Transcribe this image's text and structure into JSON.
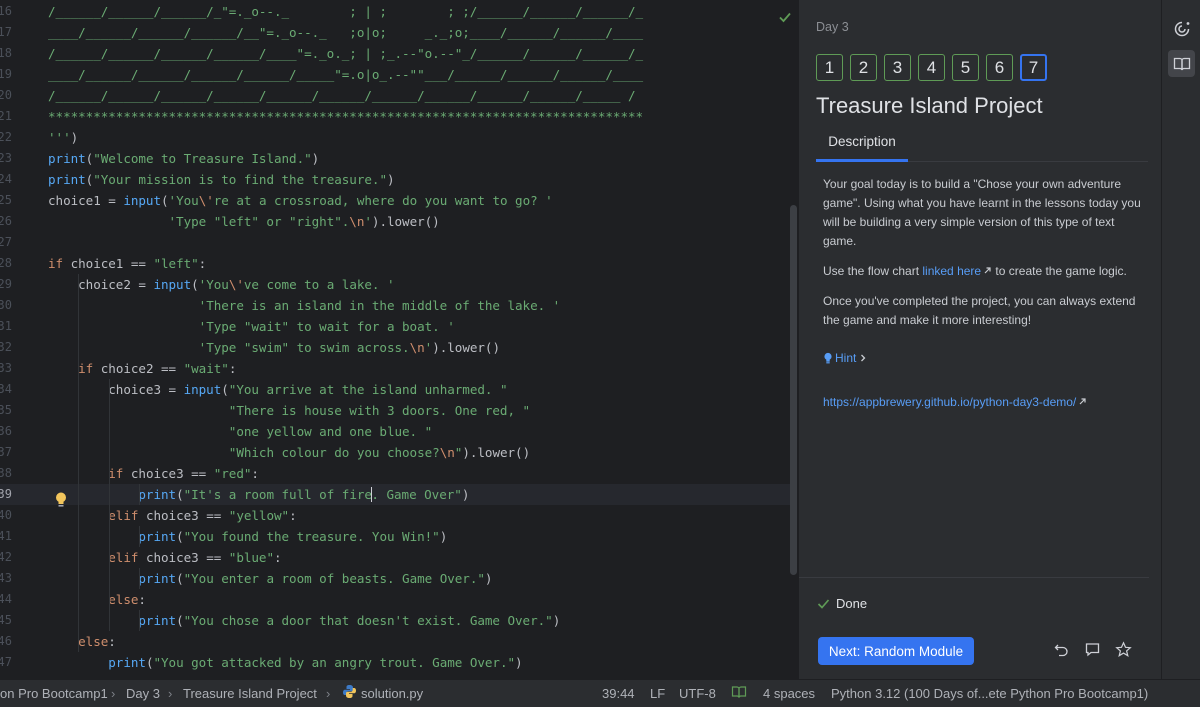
{
  "editor": {
    "lines": [
      {
        "n": "16",
        "text": "/______/______/______/_\"=._o--._        ; | ;        ; ;/______/______/______/_"
      },
      {
        "n": "17",
        "text": "____/______/______/______/__\"=._o--._   ;o|o;     _._;o;____/______/______/____"
      },
      {
        "n": "18",
        "text": "/______/______/______/______/____\"=._o._; | ;_.--\"o.--\"_/______/______/______/_"
      },
      {
        "n": "19",
        "text": "____/______/______/______/______/_____\"=.o|o_.--\"\"___/______/______/______/____"
      },
      {
        "n": "20",
        "text": "/______/______/______/______/______/______/______/______/______/______/_____ /"
      },
      {
        "n": "21",
        "text": "*******************************************************************************"
      },
      {
        "n": "22",
        "text": "''')"
      },
      {
        "n": "23",
        "text": "print(\"Welcome to Treasure Island.\")"
      },
      {
        "n": "24",
        "text": "print(\"Your mission is to find the treasure.\")"
      },
      {
        "n": "25",
        "text": "choice1 = input('You\\'re at a crossroad, where do you want to go? '"
      },
      {
        "n": "26",
        "text": "                'Type \"left\" or \"right\".\\n').lower()"
      },
      {
        "n": "27",
        "text": ""
      },
      {
        "n": "28",
        "text": "if choice1 == \"left\":"
      },
      {
        "n": "29",
        "text": "    choice2 = input('You\\'ve come to a lake. '"
      },
      {
        "n": "30",
        "text": "                    'There is an island in the middle of the lake. '"
      },
      {
        "n": "31",
        "text": "                    'Type \"wait\" to wait for a boat. '"
      },
      {
        "n": "32",
        "text": "                    'Type \"swim\" to swim across.\\n').lower()"
      },
      {
        "n": "33",
        "text": "    if choice2 == \"wait\":"
      },
      {
        "n": "34",
        "text": "        choice3 = input(\"You arrive at the island unharmed. \""
      },
      {
        "n": "35",
        "text": "                        \"There is house with 3 doors. One red, \""
      },
      {
        "n": "36",
        "text": "                        \"one yellow and one blue. \""
      },
      {
        "n": "37",
        "text": "                        \"Which colour do you choose?\\n\").lower()"
      },
      {
        "n": "38",
        "text": "        if choice3 == \"red\":"
      },
      {
        "n": "39",
        "text": "            print(\"It's a room full of fire. Game Over\")"
      },
      {
        "n": "40",
        "text": "        elif choice3 == \"yellow\":"
      },
      {
        "n": "41",
        "text": "            print(\"You found the treasure. You Win!\")"
      },
      {
        "n": "42",
        "text": "        elif choice3 == \"blue\":"
      },
      {
        "n": "43",
        "text": "            print(\"You enter a room of beasts. Game Over.\")"
      },
      {
        "n": "44",
        "text": "        else:"
      },
      {
        "n": "45",
        "text": "            print(\"You chose a door that doesn't exist. Game Over.\")"
      },
      {
        "n": "46",
        "text": "    else:"
      },
      {
        "n": "47",
        "text": "        print(\"You got attacked by an angry trout. Game Over.\")"
      }
    ],
    "current_line": "39",
    "caret_after_text": "print(\"It's a room full of fire"
  },
  "panel": {
    "day_label": "Day 3",
    "task_numbers": [
      "1",
      "2",
      "3",
      "4",
      "5",
      "6",
      "7"
    ],
    "active_task": "7",
    "title": "Treasure Island Project",
    "tab_description": "Description",
    "para1": "Your goal today is to build a \"Chose your own adventure game\". Using what you have learnt in the lessons today you will be building a very simple version of this type of text game.",
    "para2_before": "Use the flow chart ",
    "para2_link": "linked here",
    "para2_after": " to create the game logic.",
    "para3": "Once you've completed the project, you can always extend the game and make it more interesting!",
    "hint_label": "Hint",
    "demo_link": "https://appbrewery.github.io/python-day3-demo/",
    "done_label": "Done",
    "next_button": "Next: Random Module"
  },
  "status_bar": {
    "crumb_project": "on Pro Bootcamp1",
    "crumb_day": "Day 3",
    "crumb_task": "Treasure Island Project",
    "crumb_file": "solution.py",
    "position": "39:44",
    "line_ending": "LF",
    "encoding": "UTF-8",
    "indent": "4 spaces",
    "interpreter": "Python 3.12 (100 Days of...ete Python Pro Bootcamp1)"
  },
  "colors": {
    "keyword": "#cf8e6d",
    "function": "#56a8f5",
    "string": "#6aab73",
    "accent": "#3574f0",
    "success": "#5f9b56"
  }
}
